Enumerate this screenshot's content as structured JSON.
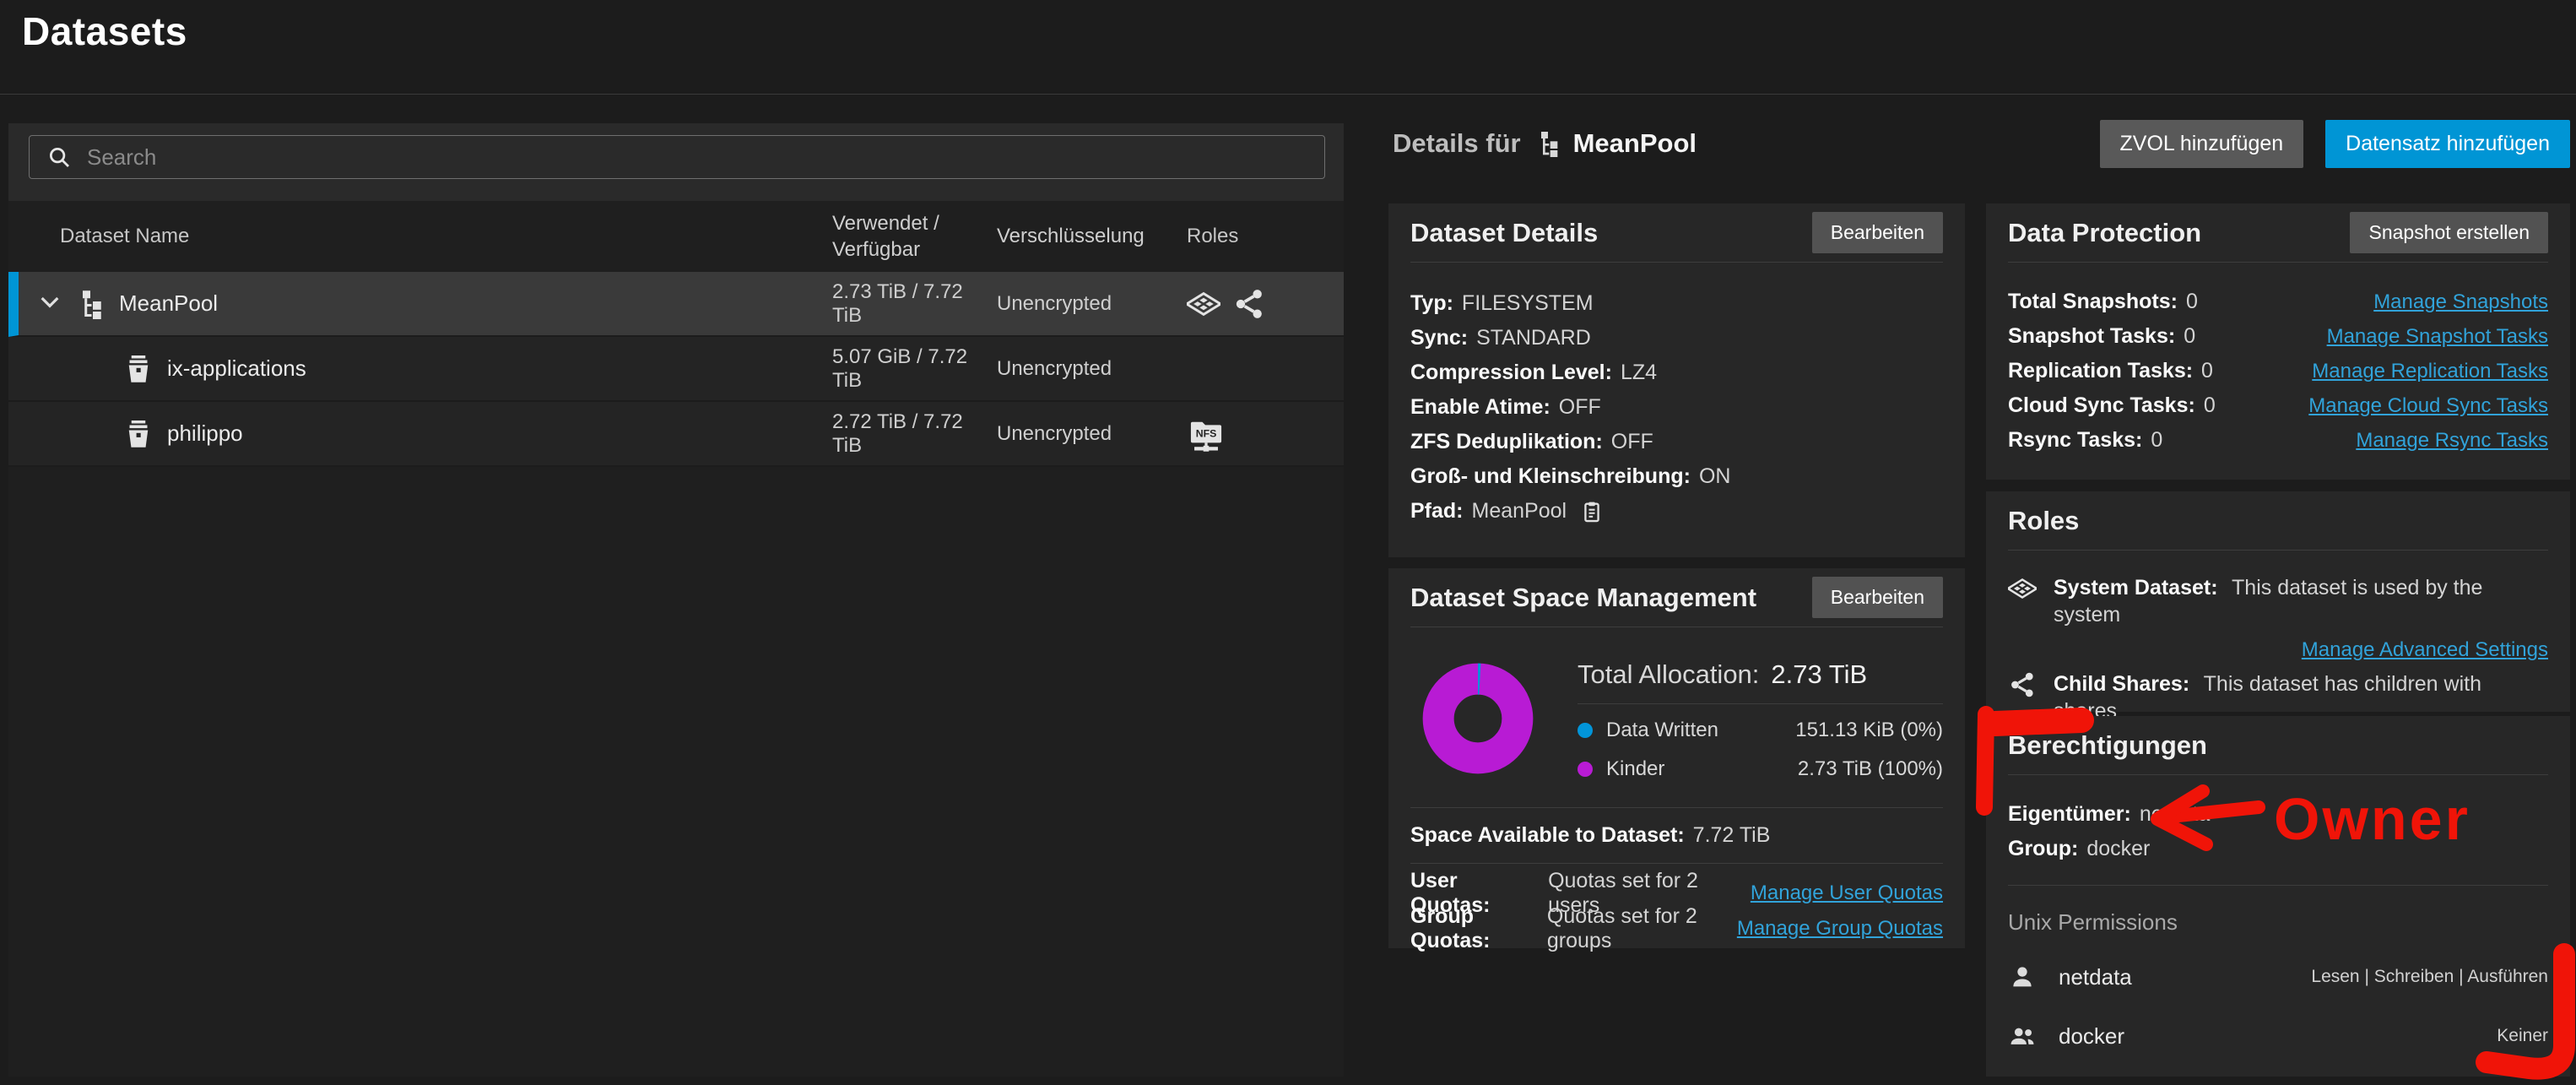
{
  "page": {
    "title": "Datasets"
  },
  "colors": {
    "accent": "#0095d5",
    "link": "#31a3da",
    "donut-written": "#0295d9",
    "donut-children": "#b81bd4",
    "annotation": "#f01408"
  },
  "search": {
    "placeholder": "Search"
  },
  "table": {
    "headers": {
      "name": "Dataset Name",
      "usage_line1": "Verwendet /",
      "usage_line2": "Verfügbar",
      "encryption": "Verschlüsselung",
      "roles": "Roles"
    },
    "rows": [
      {
        "name": "MeanPool",
        "usage": "2.73 TiB / 7.72 TiB",
        "encryption": "Unencrypted"
      },
      {
        "name": "ix-applications",
        "usage": "5.07 GiB / 7.72 TiB",
        "encryption": "Unencrypted"
      },
      {
        "name": "philippo",
        "usage": "2.72 TiB / 7.72 TiB",
        "encryption": "Unencrypted"
      }
    ]
  },
  "details_header": {
    "prefix": "Details für",
    "dataset": "MeanPool",
    "zvol_button": "ZVOL hinzufügen",
    "add_button": "Datensatz hinzufügen"
  },
  "dataset_details": {
    "title": "Dataset Details",
    "edit_button": "Bearbeiten",
    "fields": [
      {
        "label": "Typ:",
        "value": "FILESYSTEM"
      },
      {
        "label": "Sync:",
        "value": "STANDARD"
      },
      {
        "label": "Compression Level:",
        "value": "LZ4"
      },
      {
        "label": "Enable Atime:",
        "value": "OFF"
      },
      {
        "label": "ZFS Deduplikation:",
        "value": "OFF"
      },
      {
        "label": "Groß- und Kleinschreibung:",
        "value": "ON"
      },
      {
        "label": "Pfad:",
        "value": "MeanPool"
      }
    ]
  },
  "space": {
    "title": "Dataset Space Management",
    "edit_button": "Bearbeiten",
    "total_label": "Total Allocation:",
    "total_value": "2.73 TiB",
    "legend": [
      {
        "label": "Data Written",
        "value": "151.13 KiB (0%)"
      },
      {
        "label": "Kinder",
        "value": "2.73 TiB (100%)"
      }
    ],
    "available_label": "Space Available to Dataset:",
    "available_value": "7.72 TiB",
    "quotas": [
      {
        "label": "User Quotas:",
        "value": "Quotas set for 2 users",
        "link": "Manage User Quotas"
      },
      {
        "label": "Group Quotas:",
        "value": "Quotas set for 2 groups",
        "link": "Manage Group Quotas"
      }
    ]
  },
  "data_protection": {
    "title": "Data Protection",
    "snapshot_button": "Snapshot erstellen",
    "rows": [
      {
        "label": "Total Snapshots:",
        "value": "0",
        "link": "Manage Snapshots"
      },
      {
        "label": "Snapshot Tasks:",
        "value": "0",
        "link": "Manage Snapshot Tasks"
      },
      {
        "label": "Replication Tasks:",
        "value": "0",
        "link": "Manage Replication Tasks"
      },
      {
        "label": "Cloud Sync Tasks:",
        "value": "0",
        "link": "Manage Cloud Sync Tasks"
      },
      {
        "label": "Rsync Tasks:",
        "value": "0",
        "link": "Manage Rsync Tasks"
      }
    ]
  },
  "roles_card": {
    "title": "Roles",
    "system_label": "System Dataset:",
    "system_text": "This dataset is used by the system",
    "advanced_link": "Manage Advanced Settings",
    "shares_label": "Child Shares:",
    "shares_text": "This dataset has children with shares"
  },
  "permissions": {
    "title": "Berechtigungen",
    "owner_label": "Eigentümer:",
    "owner_value": "netdata",
    "group_label": "Group:",
    "group_value": "docker",
    "unix_title": "Unix Permissions",
    "entries": [
      {
        "name": "netdata",
        "perms": "Lesen | Schreiben | Ausführen"
      },
      {
        "name": "docker",
        "perms": "Keiner"
      }
    ]
  },
  "annotations": {
    "owner_text": "Owner"
  }
}
